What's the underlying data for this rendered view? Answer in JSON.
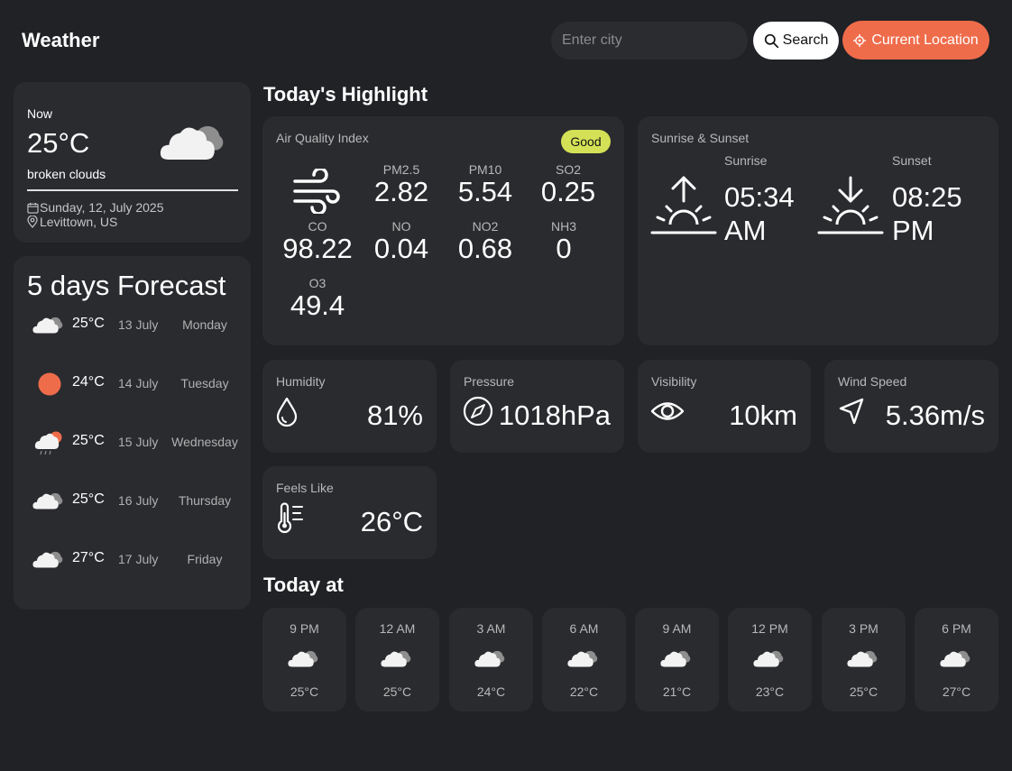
{
  "header": {
    "title": "Weather",
    "search_placeholder": "Enter city",
    "search_label": "Search",
    "location_label": "Current Location"
  },
  "current": {
    "label": "Now",
    "temp": "25°C",
    "description": "broken clouds",
    "icon": "broken-clouds-icon",
    "date": "Sunday, 12, July 2025",
    "location": "Levittown, US"
  },
  "forecast": {
    "title": "5 days Forecast",
    "days": [
      {
        "icon": "broken-clouds-icon",
        "temp": "25°C",
        "date": "13 July",
        "day": "Monday"
      },
      {
        "icon": "clear-sky-icon",
        "temp": "24°C",
        "date": "14 July",
        "day": "Tuesday"
      },
      {
        "icon": "rain-icon",
        "temp": "25°C",
        "date": "15 July",
        "day": "Wednesday"
      },
      {
        "icon": "broken-clouds-icon",
        "temp": "25°C",
        "date": "16 July",
        "day": "Thursday"
      },
      {
        "icon": "broken-clouds-icon",
        "temp": "27°C",
        "date": "17 July",
        "day": "Friday"
      }
    ]
  },
  "highlights": {
    "title": "Today's Highlight",
    "aqi": {
      "label": "Air Quality Index",
      "badge": "Good",
      "badge_color": "#d4e157",
      "pollutants": [
        {
          "name": "PM2.5",
          "value": "2.82"
        },
        {
          "name": "PM10",
          "value": "5.54"
        },
        {
          "name": "SO2",
          "value": "0.25"
        },
        {
          "name": "CO",
          "value": "98.22"
        },
        {
          "name": "NO",
          "value": "0.04"
        },
        {
          "name": "NO2",
          "value": "0.68"
        },
        {
          "name": "NH3",
          "value": "0"
        },
        {
          "name": "O3",
          "value": "49.4"
        }
      ]
    },
    "sun": {
      "label": "Sunrise & Sunset",
      "sunrise_label": "Sunrise",
      "sunrise_time": "05:34 AM",
      "sunset_label": "Sunset",
      "sunset_time": "08:25 PM"
    },
    "humidity": {
      "label": "Humidity",
      "value": "81%"
    },
    "pressure": {
      "label": "Pressure",
      "value": "1018hPa"
    },
    "visibility": {
      "label": "Visibility",
      "value": "10km"
    },
    "wind": {
      "label": "Wind Speed",
      "value": "5.36m/s"
    },
    "feels_like": {
      "label": "Feels Like",
      "value": "26°C"
    }
  },
  "hourly": {
    "title": "Today at",
    "items": [
      {
        "time": "9 PM",
        "temp": "25°C",
        "icon": "broken-clouds-icon"
      },
      {
        "time": "12 AM",
        "temp": "25°C",
        "icon": "broken-clouds-icon"
      },
      {
        "time": "3 AM",
        "temp": "24°C",
        "icon": "broken-clouds-icon"
      },
      {
        "time": "6 AM",
        "temp": "22°C",
        "icon": "broken-clouds-icon"
      },
      {
        "time": "9 AM",
        "temp": "21°C",
        "icon": "broken-clouds-icon"
      },
      {
        "time": "12 PM",
        "temp": "23°C",
        "icon": "broken-clouds-icon"
      },
      {
        "time": "3 PM",
        "temp": "25°C",
        "icon": "broken-clouds-icon"
      },
      {
        "time": "6 PM",
        "temp": "27°C",
        "icon": "broken-clouds-icon"
      }
    ]
  },
  "colors": {
    "background": "#202226",
    "card": "#2a2b2f",
    "accent": "#ef6c4b"
  }
}
